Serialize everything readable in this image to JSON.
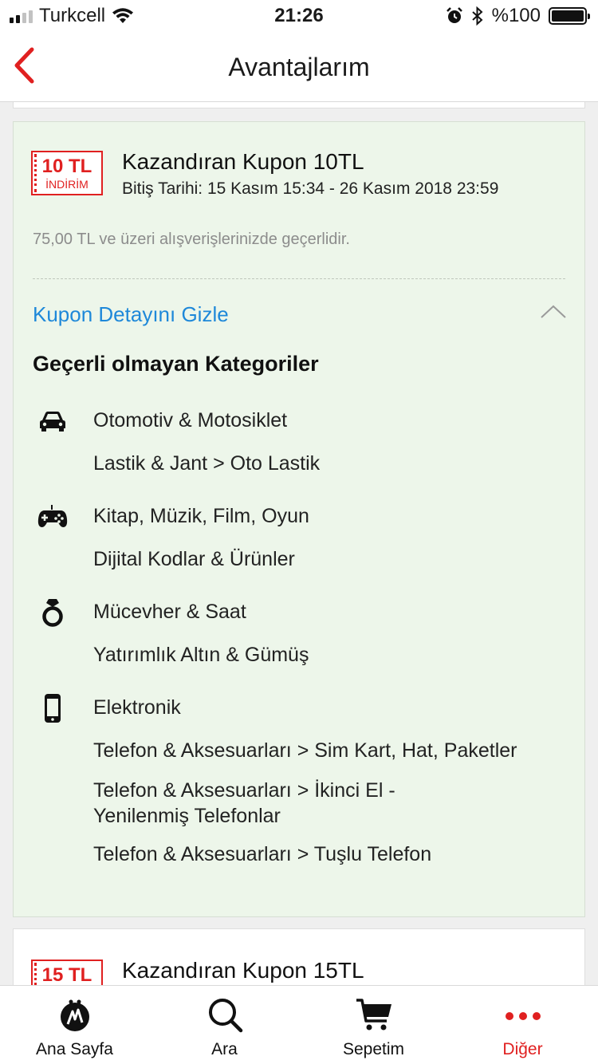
{
  "status_bar": {
    "carrier": "Turkcell",
    "time": "21:26",
    "battery": "%100"
  },
  "nav": {
    "title": "Avantajlarım"
  },
  "coupon": {
    "badge_amount": "10 TL",
    "badge_tag": "İNDİRİM",
    "title": "Kazandıran Kupon 10TL",
    "date": "Bitiş Tarihi: 15 Kasım 15:34 - 26 Kasım 2018 23:59",
    "min_note": "75,00 TL ve üzeri alışverişlerinizde geçerlidir.",
    "toggle_label": "Kupon Detayını Gizle",
    "section_title": "Geçerli olmayan Kategoriler",
    "categories": [
      {
        "icon": "car-icon",
        "name": "Otomotiv & Motosiklet",
        "subs": [
          "Lastik & Jant > Oto Lastik"
        ]
      },
      {
        "icon": "gamepad-icon",
        "name": "Kitap, Müzik, Film, Oyun",
        "subs": [
          "Dijital Kodlar & Ürünler"
        ]
      },
      {
        "icon": "ring-icon",
        "name": "Mücevher & Saat",
        "subs": [
          "Yatırımlık Altın & Gümüş"
        ]
      },
      {
        "icon": "phone-icon",
        "name": "Elektronik",
        "subs": [
          "Telefon & Aksesuarları > Sim Kart, Hat, Paketler",
          "Telefon & Aksesuarları > İkinci El - Yenilenmiş Telefonlar",
          "Telefon & Aksesuarları > Tuşlu Telefon"
        ]
      }
    ]
  },
  "next_coupon": {
    "badge_amount": "15 TL",
    "title": "Kazandıran Kupon 15TL"
  },
  "tabs": [
    {
      "label": "Ana Sayfa",
      "icon": "home-logo-icon",
      "active": false
    },
    {
      "label": "Ara",
      "icon": "search-icon",
      "active": false
    },
    {
      "label": "Sepetim",
      "icon": "cart-icon",
      "active": false
    },
    {
      "label": "Diğer",
      "icon": "more-dots-icon",
      "active": true
    }
  ],
  "colors": {
    "accent": "#e02020",
    "link": "#1e88d9",
    "card_bg": "#edf6ea"
  }
}
